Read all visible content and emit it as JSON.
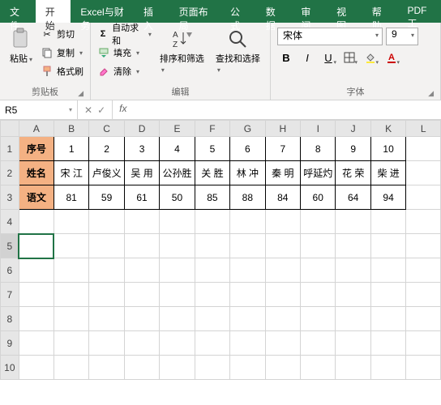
{
  "menubar": {
    "tabs": [
      "文件",
      "开始",
      "Excel与财务",
      "插入",
      "页面布局",
      "公式",
      "数据",
      "审阅",
      "视图",
      "帮助",
      "PDF工"
    ],
    "active": 1
  },
  "ribbon": {
    "clipboard": {
      "paste": "粘贴",
      "cut": "剪切",
      "copy": "复制",
      "painter": "格式刷",
      "label": "剪贴板"
    },
    "editing": {
      "autosum": "自动求和",
      "fill": "填充",
      "clear": "清除",
      "sort": "排序和筛选",
      "find": "查找和选择",
      "label": "编辑"
    },
    "font": {
      "name": "宋体",
      "size": "9",
      "label": "字体"
    }
  },
  "namebox": {
    "ref": "R5"
  },
  "sheet": {
    "columns": [
      "A",
      "B",
      "C",
      "D",
      "E",
      "F",
      "G",
      "H",
      "I",
      "J",
      "K",
      "L"
    ],
    "row_headers": [
      "序号",
      "姓名",
      "语文"
    ],
    "data": [
      [
        "1",
        "2",
        "3",
        "4",
        "5",
        "6",
        "7",
        "8",
        "9",
        "10"
      ],
      [
        "宋 江",
        "卢俊义",
        "吴 用",
        "公孙胜",
        "关 胜",
        "林 冲",
        "秦 明",
        "呼延灼",
        "花 荣",
        "柴 进"
      ],
      [
        "81",
        "59",
        "61",
        "50",
        "85",
        "88",
        "84",
        "60",
        "64",
        "94"
      ]
    ],
    "rows_total": 10,
    "selected": "R5"
  },
  "chart_data": {
    "type": "table",
    "title": "",
    "columns": [
      "序号",
      "姓名",
      "语文"
    ],
    "rows": [
      {
        "序号": 1,
        "姓名": "宋 江",
        "语文": 81
      },
      {
        "序号": 2,
        "姓名": "卢俊义",
        "语文": 59
      },
      {
        "序号": 3,
        "姓名": "吴 用",
        "语文": 61
      },
      {
        "序号": 4,
        "姓名": "公孙胜",
        "语文": 50
      },
      {
        "序号": 5,
        "姓名": "关 胜",
        "语文": 85
      },
      {
        "序号": 6,
        "姓名": "林 冲",
        "语文": 88
      },
      {
        "序号": 7,
        "姓名": "秦 明",
        "语文": 84
      },
      {
        "序号": 8,
        "姓名": "呼延灼",
        "语文": 60
      },
      {
        "序号": 9,
        "姓名": "花 荣",
        "语文": 64
      },
      {
        "序号": 10,
        "姓名": "柴 进",
        "语文": 94
      }
    ]
  }
}
